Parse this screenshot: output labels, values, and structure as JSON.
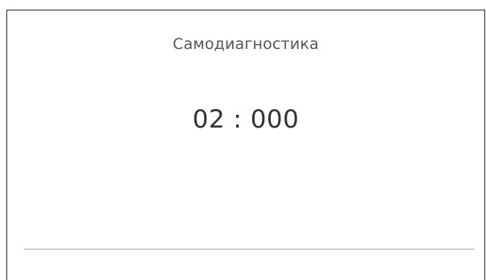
{
  "dialog": {
    "title": "Самодиагностика",
    "value": "02 : 000"
  }
}
